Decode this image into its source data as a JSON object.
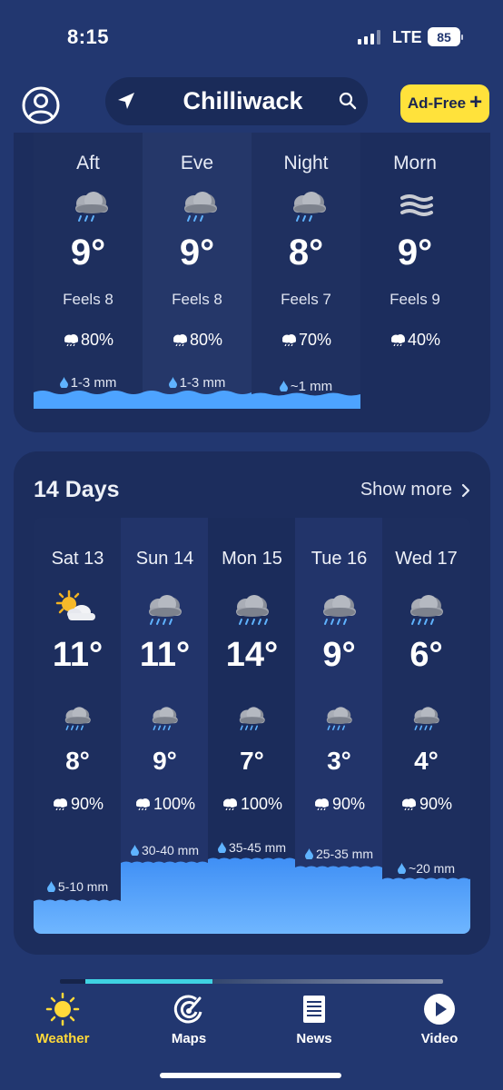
{
  "status_bar": {
    "time": "8:15",
    "network": "LTE",
    "battery": "85"
  },
  "header": {
    "city": "Chilliwack",
    "ad_free_label": "Ad-Free",
    "ad_free_plus": "+"
  },
  "hourly": [
    {
      "label": "Aft",
      "icon": "cloud-rain-icon",
      "temp": "9°",
      "feels": "Feels 8",
      "pop": "80%",
      "precip": "1-3 mm"
    },
    {
      "label": "Eve",
      "icon": "cloud-rain-icon",
      "temp": "9°",
      "feels": "Feels 8",
      "pop": "80%",
      "precip": "1-3 mm"
    },
    {
      "label": "Night",
      "icon": "cloud-rain-icon",
      "temp": "8°",
      "feels": "Feels 7",
      "pop": "70%",
      "precip": "~1 mm"
    },
    {
      "label": "Morn",
      "icon": "fog-icon",
      "temp": "9°",
      "feels": "Feels 9",
      "pop": "40%",
      "precip": ""
    }
  ],
  "fourteen_days": {
    "title": "14 Days",
    "show_more": "Show more",
    "days": [
      {
        "day": "Sat 13",
        "icon": "partly-sunny-icon",
        "high": "11°",
        "night_icon": "cloud-rain-icon",
        "low": "8°",
        "pop": "90%",
        "precip": "5-10 mm"
      },
      {
        "day": "Sun 14",
        "icon": "cloud-rain-icon",
        "high": "11°",
        "night_icon": "cloud-rain-icon",
        "low": "9°",
        "pop": "100%",
        "precip": "30-40 mm"
      },
      {
        "day": "Mon 15",
        "icon": "cloud-heavy-rain-icon",
        "high": "14°",
        "night_icon": "cloud-rain-icon",
        "low": "7°",
        "pop": "100%",
        "precip": "35-45 mm"
      },
      {
        "day": "Tue 16",
        "icon": "cloud-rain-icon",
        "high": "9°",
        "night_icon": "cloud-rain-icon",
        "low": "3°",
        "pop": "90%",
        "precip": "25-35 mm"
      },
      {
        "day": "Wed 17",
        "icon": "cloud-rain-icon",
        "high": "6°",
        "night_icon": "cloud-rain-icon",
        "low": "4°",
        "pop": "90%",
        "precip": "~20 mm"
      }
    ]
  },
  "tabs": [
    {
      "label": "Weather",
      "icon": "sun-icon",
      "active": true
    },
    {
      "label": "Maps",
      "icon": "radar-icon",
      "active": false
    },
    {
      "label": "News",
      "icon": "news-icon",
      "active": false
    },
    {
      "label": "Video",
      "icon": "play-icon",
      "active": false
    }
  ],
  "colors": {
    "background": "#223770",
    "card": "#1c2d5d",
    "accent_yellow": "#ffe23b",
    "rain_blue": "#4da3ff"
  }
}
